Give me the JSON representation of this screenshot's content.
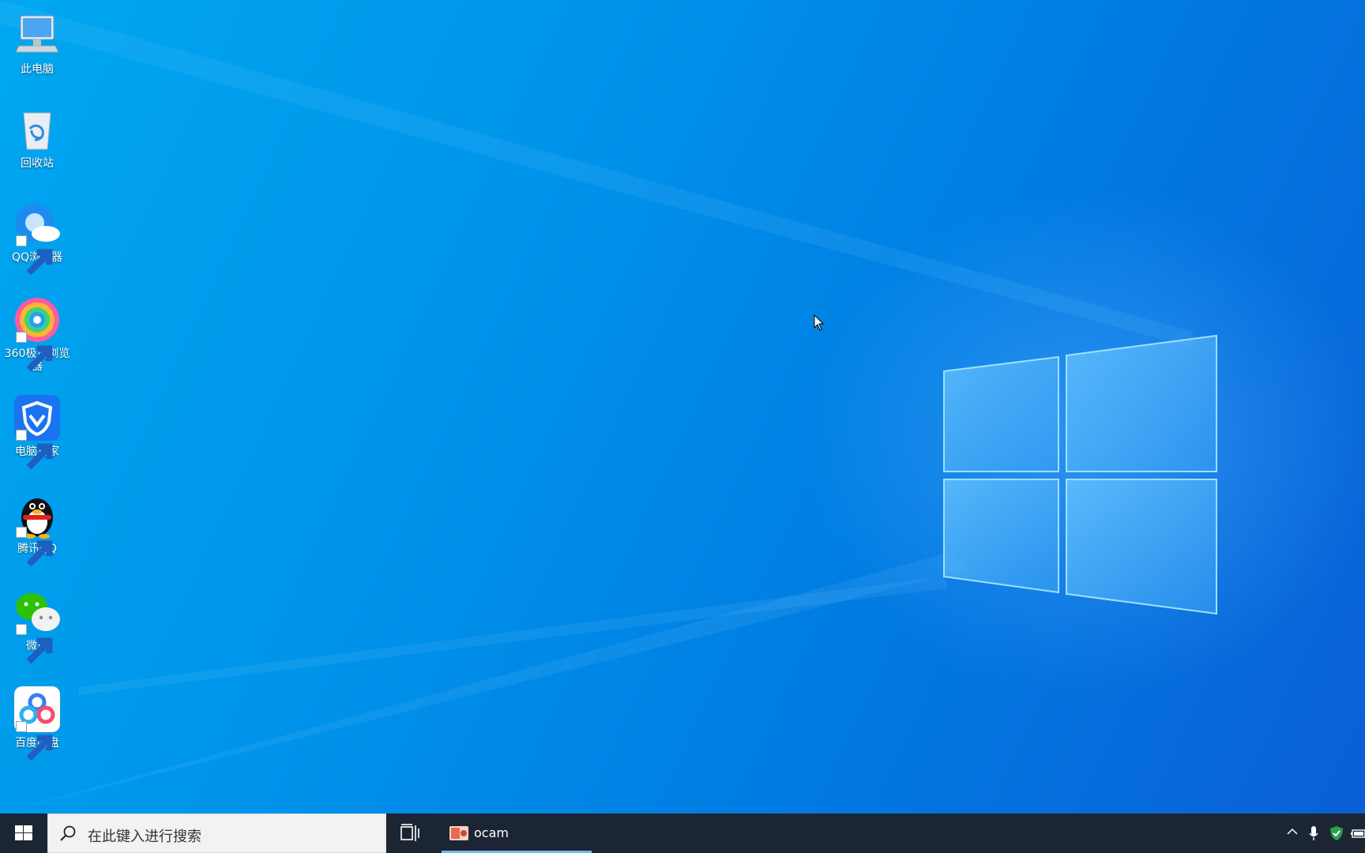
{
  "desktop": {
    "icons": [
      {
        "label": "此电脑",
        "icon": "this-pc-icon",
        "shortcut": false
      },
      {
        "label": "回收站",
        "icon": "recycle-bin-icon",
        "shortcut": false
      },
      {
        "label": "QQ浏览器",
        "icon": "qq-browser-icon",
        "shortcut": true
      },
      {
        "label": "360极速浏览器",
        "icon": "360-browser-icon",
        "shortcut": true
      },
      {
        "label": "电脑管家",
        "icon": "pc-manager-icon",
        "shortcut": true
      },
      {
        "label": "腾讯QQ",
        "icon": "qq-penguin-icon",
        "shortcut": true
      },
      {
        "label": "微信",
        "icon": "wechat-icon",
        "shortcut": true
      },
      {
        "label": "百度网盘",
        "icon": "baidu-netdisk-icon",
        "shortcut": true
      }
    ]
  },
  "taskbar": {
    "search_placeholder": "在此键入进行搜索",
    "running_app": {
      "label": "ocam",
      "icon": "ocam-icon"
    },
    "tray_icons": [
      "chevron-up-icon",
      "microphone-icon",
      "security-shield-icon",
      "battery-icon"
    ]
  },
  "colors": {
    "taskbar": "#1c2533",
    "desktop_blue": "#0094ea",
    "active_indicator": "#76b9ed"
  }
}
